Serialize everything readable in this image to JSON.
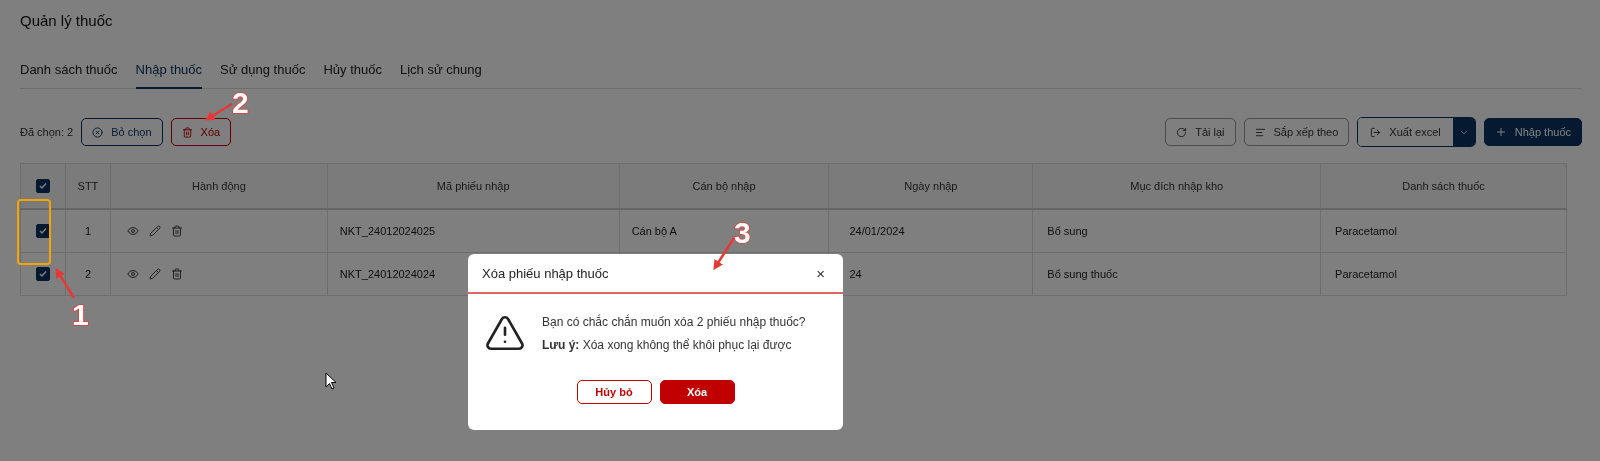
{
  "page_title": "Quản lý thuốc",
  "tabs": [
    {
      "label": "Danh sách thuốc",
      "selected": false
    },
    {
      "label": "Nhập thuốc",
      "selected": true
    },
    {
      "label": "Sử dụng thuốc",
      "selected": false
    },
    {
      "label": "Hủy thuốc",
      "selected": false
    },
    {
      "label": "Lịch sử chung",
      "selected": false
    }
  ],
  "toolbar": {
    "selected_count": "Đã chọn: 2",
    "clear_button": "Bỏ chọn",
    "delete_button": "Xóa",
    "reload_button": "Tải lại",
    "sort_button": "Sắp xếp theo",
    "export_button": "Xuất excel",
    "import_button": "Nhập thuốc"
  },
  "table": {
    "all_checked": true,
    "columns": [
      "STT",
      "Hành động",
      "Mã phiếu nhập",
      "Cán bộ nhập",
      "Ngày nhập",
      "Mục đích nhập kho",
      "Danh sách thuốc"
    ],
    "rows": [
      {
        "checked": true,
        "stt": "1",
        "code": "NKT_24012024025",
        "officer": "Cán bộ A",
        "date": "24/01/2024",
        "purpose": "Bổ sung",
        "medicines": "Paracetamol"
      },
      {
        "checked": true,
        "stt": "2",
        "code": "NKT_24012024024",
        "date": "24",
        "purpose": "Bổ sung thuốc",
        "medicines": "Paracetamol"
      }
    ]
  },
  "dialog": {
    "title": "Xóa phiếu nhập thuốc",
    "close": "×",
    "question": "Bạn có chắc chắn muốn xóa 2 phiếu nhập thuốc?",
    "note": "**Lưu ý:** Xóa xong không thể khôi phục lại được",
    "cancel_button": "Hủy bỏ",
    "confirm_button": "Xóa"
  },
  "callouts": [
    {
      "label": "1"
    },
    {
      "label": "2"
    },
    {
      "label": "3"
    }
  ]
}
